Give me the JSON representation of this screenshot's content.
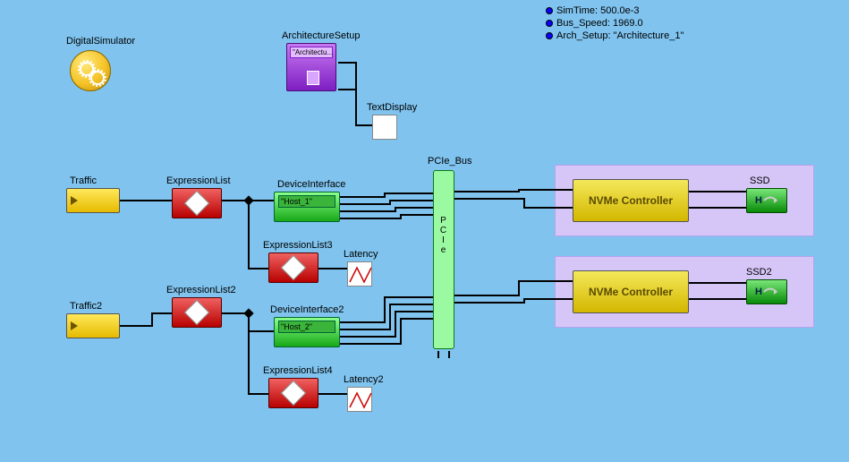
{
  "title": "DigitalSimulator",
  "status": [
    {
      "label": "SimTime",
      "value": "500.0e-3"
    },
    {
      "label": "Bus_Speed",
      "value": "1969.0"
    },
    {
      "label": "Arch_Setup",
      "value": "\"Architecture_1\""
    }
  ],
  "colors": {
    "canvas": "#7fc3ee",
    "traffic": "#f5c328",
    "expr": "#d62020",
    "device": "#2fb82f",
    "bus": "#9bfaa1",
    "nvme": "#e6d21a",
    "ssd": "#2fb82f",
    "arch": "#8e2cd6",
    "group": "#d6c6f8"
  },
  "blocks": {
    "medallion": {
      "label": "DigitalSimulator"
    },
    "arch_setup": {
      "label": "ArchitectureSetup",
      "tag": "\"Architectu..."
    },
    "text_display": {
      "label": "TextDisplay"
    },
    "traffic1": {
      "label": "Traffic"
    },
    "traffic2": {
      "label": "Traffic2"
    },
    "expr1": {
      "label": "ExpressionList"
    },
    "expr2": {
      "label": "ExpressionList2"
    },
    "expr3": {
      "label": "ExpressionList3"
    },
    "expr4": {
      "label": "ExpressionList4"
    },
    "dev1": {
      "label": "DeviceInterface",
      "host": "\"Host_1\""
    },
    "dev2": {
      "label": "DeviceInterface2",
      "host": "\"Host_2\""
    },
    "lat1": {
      "label": "Latency"
    },
    "lat2": {
      "label": "Latency2"
    },
    "bus": {
      "label": "PCIe_Bus",
      "text": "PCIe"
    },
    "nvme1": {
      "label": "NVMe Controller"
    },
    "nvme2": {
      "label": "NVMe Controller"
    },
    "ssd1": {
      "label": "SSD"
    },
    "ssd2": {
      "label": "SSD2"
    }
  }
}
